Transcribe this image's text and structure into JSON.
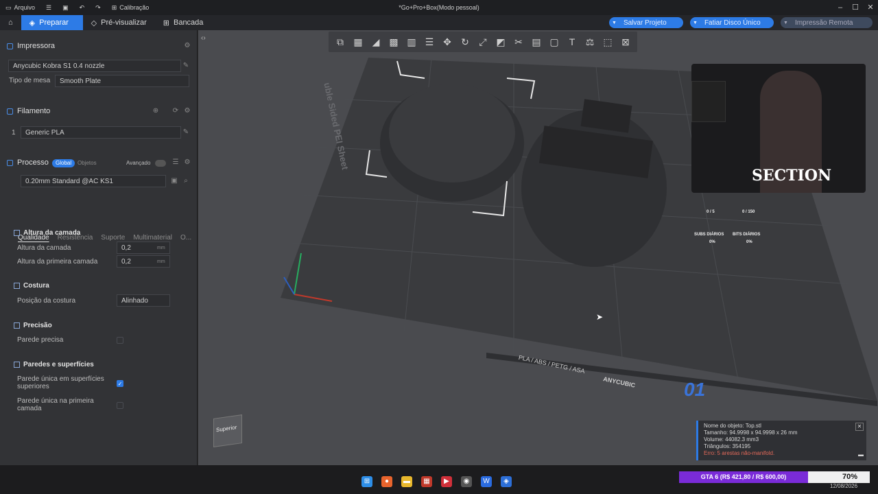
{
  "titlebar": {
    "file_menu": "Arquivo",
    "calibration": "Calibração",
    "window_title": "*Go+Pro+Box(Modo pessoal)"
  },
  "tabs": [
    {
      "label": "Preparar"
    },
    {
      "label": "Pré-visualizar"
    },
    {
      "label": "Bancada"
    }
  ],
  "actions": {
    "save_project": "Salvar Projeto",
    "slice_plate": "Fatiar Disco Único",
    "remote_print": "Impressão Remota"
  },
  "printer": {
    "header": "Impressora",
    "selected": "Anycubic Kobra S1 0.4 nozzle",
    "plate_label": "Tipo de mesa",
    "plate_value": "Smooth Plate"
  },
  "filament": {
    "header": "Filamento",
    "slot": "1",
    "value": "Generic PLA"
  },
  "process": {
    "header": "Processo",
    "global_label": "Global",
    "objects_label": "Objetos",
    "advanced_label": "Avançado",
    "preset": "0.20mm Standard @AC KS1"
  },
  "subtabs": [
    "Qualidade",
    "Resistência",
    "Suporte",
    "Multimaterial",
    "O..."
  ],
  "quality": {
    "layer_group": "Altura da camada",
    "layer_height_label": "Altura da camada",
    "layer_height_value": "0,2",
    "first_layer_label": "Altura da primeira camada",
    "first_layer_value": "0,2",
    "unit": "mm",
    "seam_group": "Costura",
    "seam_label": "Posição da costura",
    "seam_value": "Alinhado",
    "precision_group": "Precisão",
    "precise_wall_label": "Parede precisa",
    "walls_group": "Paredes e superfícies",
    "single_top_label": "Parede única em superfícies superiores",
    "single_first_label": "Parede única na primeira camada"
  },
  "viewport": {
    "plate_text_side": "uble Sided PEI Sheet",
    "plate_text_front": "PLA / ABS / PETG / ASA",
    "plate_brand": "ANYCUBIC",
    "plate_number": "01",
    "cube_label": "Superior"
  },
  "stream_overlay": {
    "subs_label": "SUBS DIÁRIOS",
    "subs_count": "0 / 5",
    "subs_pct": "0%",
    "bits_label": "BITS DIÁRIOS",
    "bits_count": "0 / 150",
    "bits_pct": "0%",
    "channel_logo": "SECTION"
  },
  "object_info": {
    "name": "Nome do objeto: Top.stl",
    "size": "Tamanho: 94.9998 x 94.9998 x 26 mm",
    "volume": "Volume: 44082.3 mm3",
    "triangles": "Triângulos: 354195",
    "error": "Erro: 5 arestas não-manifold."
  },
  "goal_bar": {
    "text": "GTA 6 (R$ 421,80 / R$ 600,00)",
    "percent_text": "70%",
    "progress": 0.7
  },
  "taskbar": {
    "date": "12/08/2026"
  },
  "colors": {
    "accent": "#2d7be6",
    "error": "#e56a5a",
    "goal_bar": "#7a2bd8"
  }
}
